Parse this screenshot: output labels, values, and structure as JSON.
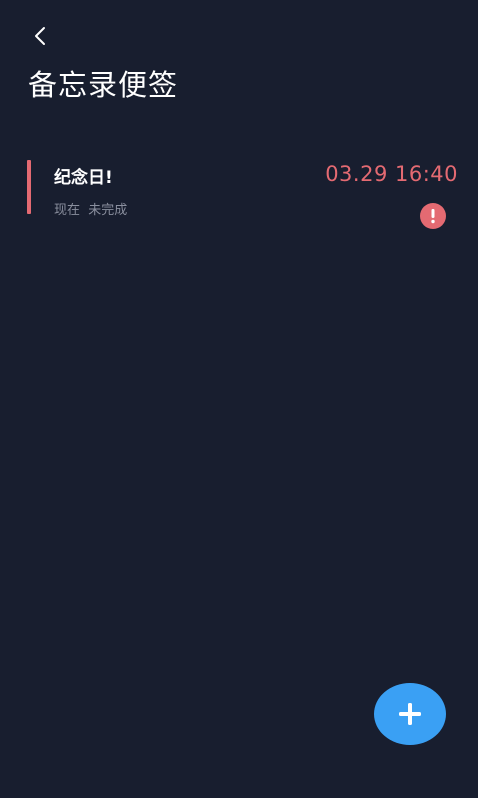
{
  "header": {
    "back_icon": "chevron-left-icon",
    "title": "备忘录便签"
  },
  "memos": [
    {
      "title": "纪念日!",
      "status": "现在  未完成",
      "time": "03.29 16:40",
      "accent_color": "#e46a72",
      "alert_icon": "exclamation-circle-icon"
    }
  ],
  "fab": {
    "icon": "plus-icon",
    "color": "#3aa0f4"
  },
  "colors": {
    "background": "#181e2f",
    "accent": "#e46a72",
    "secondary_text": "#8a8f9e"
  }
}
